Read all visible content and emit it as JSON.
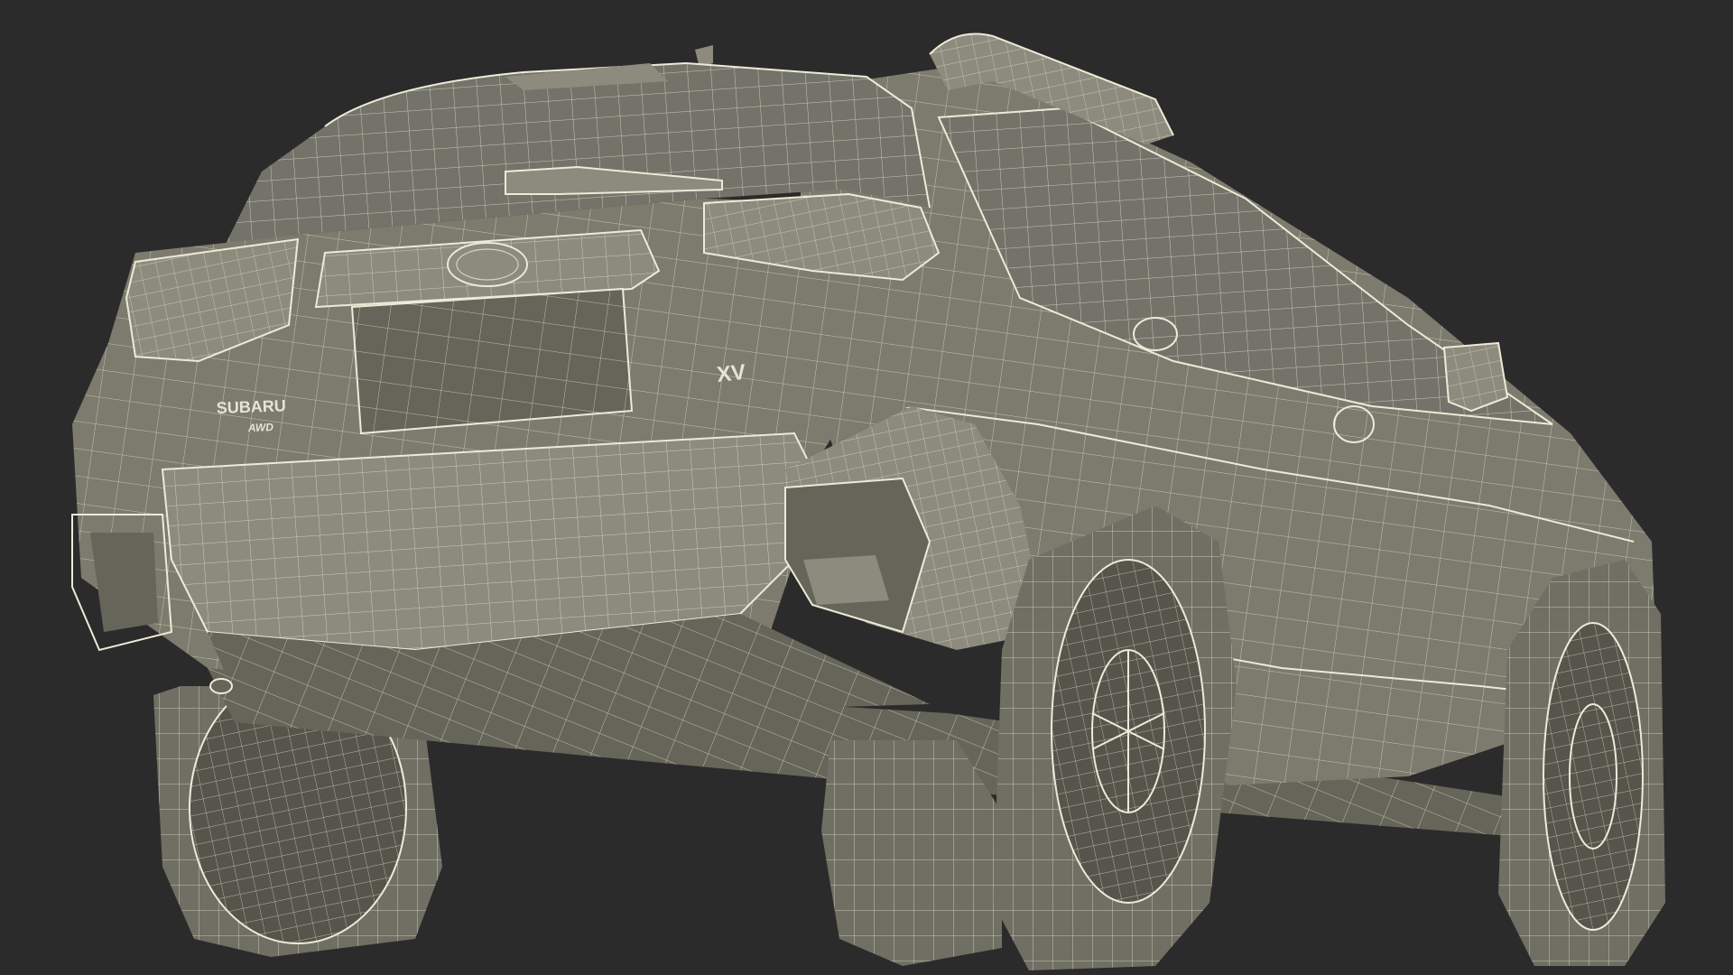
{
  "scene": {
    "background_color": "#2b2b2b",
    "body_color": "#7c7b6e",
    "wire_color": "#e3e2cf"
  },
  "badges": {
    "brand": "SUBARU",
    "awd": "AWD",
    "model": "XV"
  },
  "icons": {
    "emblem": "subaru-oval-emblem-icon"
  }
}
